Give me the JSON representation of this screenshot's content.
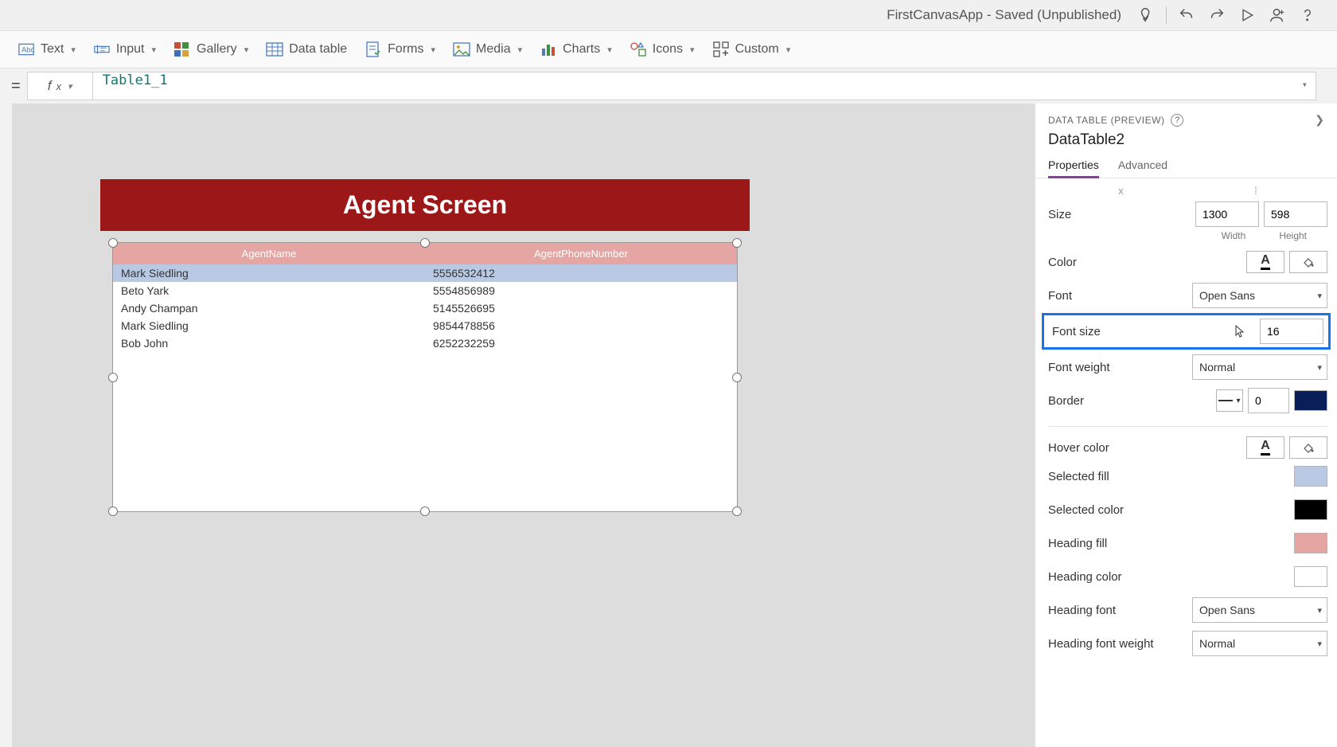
{
  "title": "FirstCanvasApp - Saved (Unpublished)",
  "toolbar": {
    "text": "Text",
    "input": "Input",
    "gallery": "Gallery",
    "datatable": "Data table",
    "forms": "Forms",
    "media": "Media",
    "charts": "Charts",
    "icons": "Icons",
    "custom": "Custom"
  },
  "formula": "Table1_1",
  "canvas": {
    "banner": "Agent Screen",
    "columns": [
      "AgentName",
      "AgentPhoneNumber"
    ],
    "rows": [
      {
        "name": "Mark Siedling",
        "phone": "5556532412"
      },
      {
        "name": "Beto Yark",
        "phone": "5554856989"
      },
      {
        "name": "Andy Champan",
        "phone": "5145526695"
      },
      {
        "name": "Mark Siedling",
        "phone": "9854478856"
      },
      {
        "name": "Bob John",
        "phone": "6252232259"
      }
    ]
  },
  "panel": {
    "header": "DATA TABLE (PREVIEW)",
    "name": "DataTable2",
    "tabs": {
      "properties": "Properties",
      "advanced": "Advanced"
    },
    "props": {
      "size_label": "Size",
      "width_val": "1300",
      "height_val": "598",
      "width_lbl": "Width",
      "height_lbl": "Height",
      "color_label": "Color",
      "font_label": "Font",
      "font_val": "Open Sans",
      "fontsize_label": "Font size",
      "fontsize_val": "16",
      "fontweight_label": "Font weight",
      "fontweight_val": "Normal",
      "border_label": "Border",
      "border_val": "0",
      "border_color": "#0A1E5A",
      "hover_label": "Hover color",
      "selfill_label": "Selected fill",
      "selfill_color": "#BAC9E3",
      "selcolor_label": "Selected color",
      "selcolor_color": "#000000",
      "headfill_label": "Heading fill",
      "headfill_color": "#E5A5A3",
      "headcolor_label": "Heading color",
      "headcolor_color": "#FFFFFF",
      "headfont_label": "Heading font",
      "headfont_val": "Open Sans",
      "headfw_label": "Heading font weight",
      "headfw_val": "Normal"
    }
  }
}
